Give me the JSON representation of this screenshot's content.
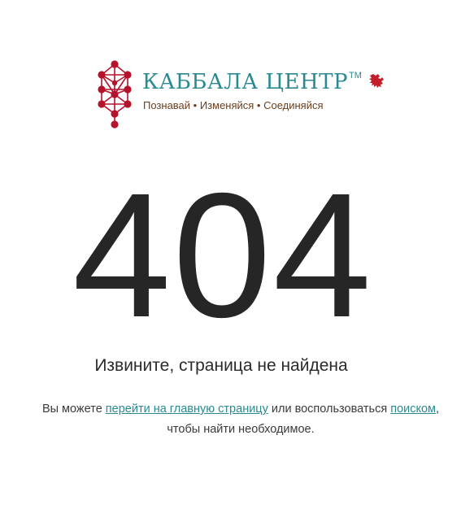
{
  "logo": {
    "title": "КАББАЛА ЦЕНТР",
    "trademark": "TM",
    "tagline": "Познавай  •  Изменяйся  •  Соединяйся",
    "tree_icon": "kabbalah-tree-of-life-icon",
    "lion_icon": "lion-emblem-icon",
    "title_color": "#2a8a91",
    "tagline_color": "#6b3e1e",
    "tree_color": "#b5122c",
    "lion_color": "#c41e2a"
  },
  "error": {
    "code": "404",
    "message": "Извините, страница не найдена"
  },
  "hint": {
    "prefix": "Вы можете ",
    "home_link": "перейти на главную страницу",
    "middle": " или воспользоваться ",
    "search_link": "поиском",
    "suffix": ",",
    "line2": "чтобы найти необходимое.",
    "link_color": "#2a8a91"
  }
}
